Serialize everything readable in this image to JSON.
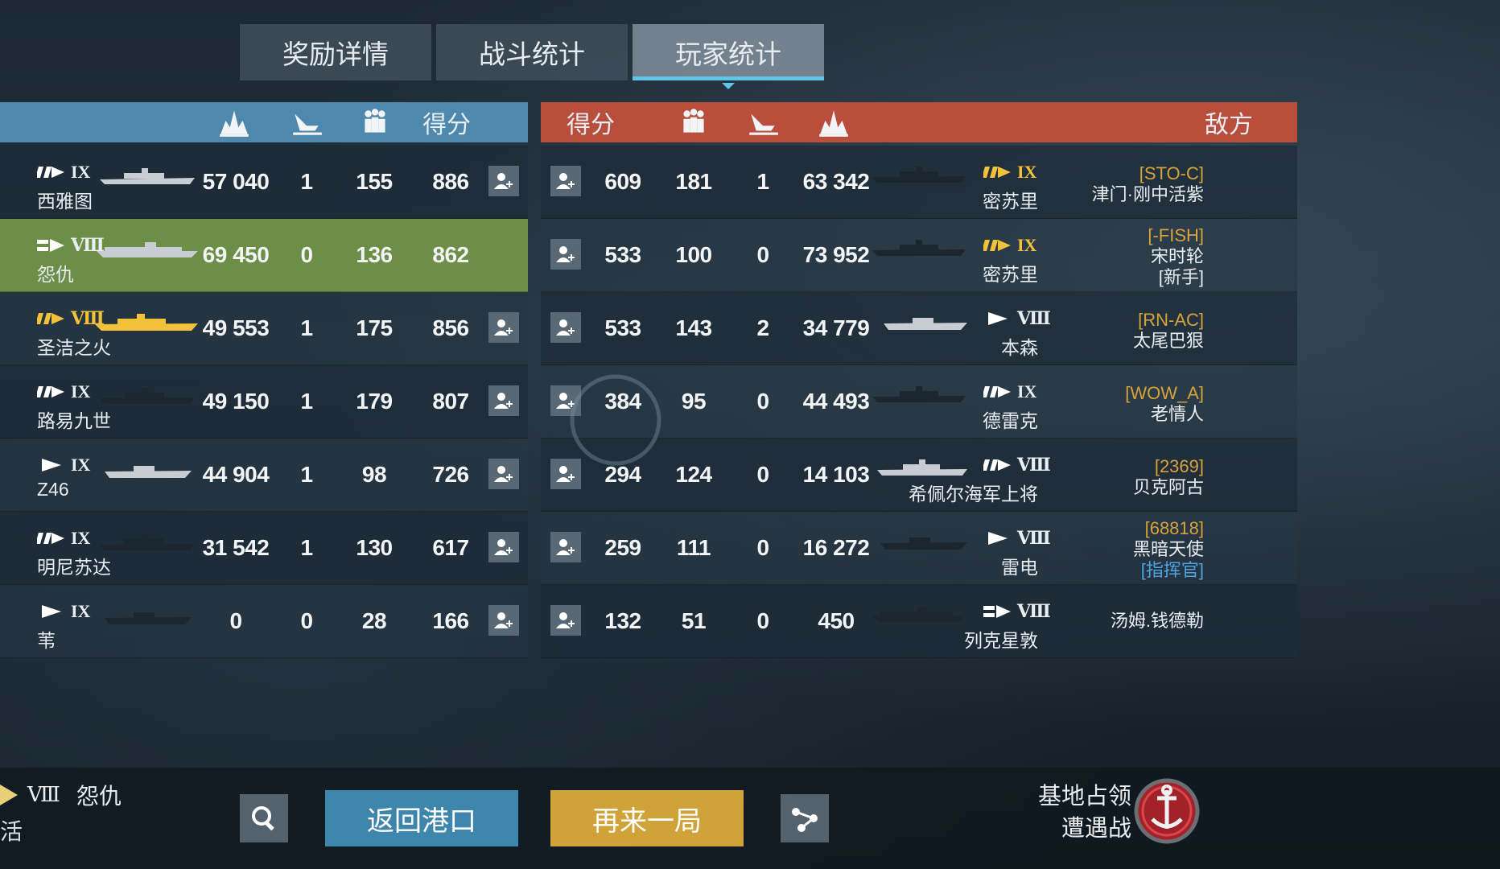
{
  "tabs": [
    {
      "label": "奖励详情",
      "active": false
    },
    {
      "label": "战斗统计",
      "active": false
    },
    {
      "label": "玩家统计",
      "active": true
    }
  ],
  "header": {
    "ally_score_label": "得分",
    "enemy_score_label": "得分",
    "enemy_label": "敌方"
  },
  "ally_rows": [
    {
      "tier": "IX",
      "type": "battleship",
      "ship": "西雅图",
      "damage": "57 040",
      "kills": "1",
      "exp": "155",
      "score": "886",
      "self": false,
      "premium": false
    },
    {
      "tier": "Ⅷ",
      "type": "destroyer",
      "ship": "怨仇",
      "damage": "69 450",
      "kills": "0",
      "exp": "136",
      "score": "862",
      "self": true,
      "premium": false
    },
    {
      "tier": "Ⅷ",
      "type": "battleship",
      "ship": "圣洁之火",
      "damage": "49 553",
      "kills": "1",
      "exp": "175",
      "score": "856",
      "self": false,
      "premium": true
    },
    {
      "tier": "IX",
      "type": "battleship",
      "ship": "路易九世",
      "damage": "49 150",
      "kills": "1",
      "exp": "179",
      "score": "807",
      "self": false,
      "premium": false
    },
    {
      "tier": "IX",
      "type": "destroyer",
      "ship": "Z46",
      "damage": "44 904",
      "kills": "1",
      "exp": "98",
      "score": "726",
      "self": false,
      "premium": false
    },
    {
      "tier": "IX",
      "type": "battleship",
      "ship": "明尼苏达",
      "damage": "31 542",
      "kills": "1",
      "exp": "130",
      "score": "617",
      "self": false,
      "premium": false
    },
    {
      "tier": "IX",
      "type": "destroyer",
      "ship": "苇",
      "damage": "0",
      "kills": "0",
      "exp": "28",
      "score": "166",
      "self": false,
      "premium": false
    }
  ],
  "enemy_rows": [
    {
      "score": "609",
      "exp": "181",
      "kills": "1",
      "damage": "63 342",
      "tier": "IX",
      "type": "battleship",
      "ship": "密苏里",
      "premium": true,
      "clan": "[STO-C]",
      "player": "津门·刚中活紫",
      "extra": ""
    },
    {
      "score": "533",
      "exp": "100",
      "kills": "0",
      "damage": "73 952",
      "tier": "IX",
      "type": "battleship",
      "ship": "密苏里",
      "premium": true,
      "clan": "[-FISH]",
      "player": "宋时轮",
      "extra": "[新手]"
    },
    {
      "score": "533",
      "exp": "143",
      "kills": "2",
      "damage": "34 779",
      "tier": "Ⅷ",
      "type": "destroyer",
      "ship": "本森",
      "premium": false,
      "clan": "[RN-AC]",
      "player": "太尾巴狠",
      "extra": ""
    },
    {
      "score": "384",
      "exp": "95",
      "kills": "0",
      "damage": "44 493",
      "tier": "IX",
      "type": "battleship",
      "ship": "德雷克",
      "premium": false,
      "clan": "[WOW_A]",
      "player": "老情人",
      "extra": ""
    },
    {
      "score": "294",
      "exp": "124",
      "kills": "0",
      "damage": "14 103",
      "tier": "Ⅷ",
      "type": "battleship",
      "ship": "希佩尔海军上将",
      "premium": false,
      "clan": "[2369]",
      "player": "贝克阿古",
      "extra": ""
    },
    {
      "score": "259",
      "exp": "111",
      "kills": "0",
      "damage": "16 272",
      "tier": "Ⅷ",
      "type": "destroyer",
      "ship": "雷电",
      "premium": false,
      "clan": "[68818]",
      "player": "黑暗天使",
      "extra": "[指挥官]"
    },
    {
      "score": "132",
      "exp": "51",
      "kills": "0",
      "damage": "450",
      "tier": "Ⅷ",
      "type": "cruiser",
      "ship": "列克星敦",
      "premium": false,
      "clan": "",
      "player": "汤姆.钱德勒",
      "extra": ""
    }
  ],
  "bottom": {
    "ship_tier": "Ⅷ",
    "ship_name": "怨仇",
    "status_fragment": "活",
    "back_to_port": "返回港口",
    "play_again": "再来一局",
    "mode_line1": "基地占领",
    "mode_line2": "遭遇战"
  },
  "colors": {
    "ally_header": "#4e89ad",
    "enemy_header": "#b94e3d",
    "self_row": "#729448",
    "play_again": "#cfa33a",
    "back_to_port": "#3f86ad",
    "tab_active_underline": "#5fc6e8"
  }
}
